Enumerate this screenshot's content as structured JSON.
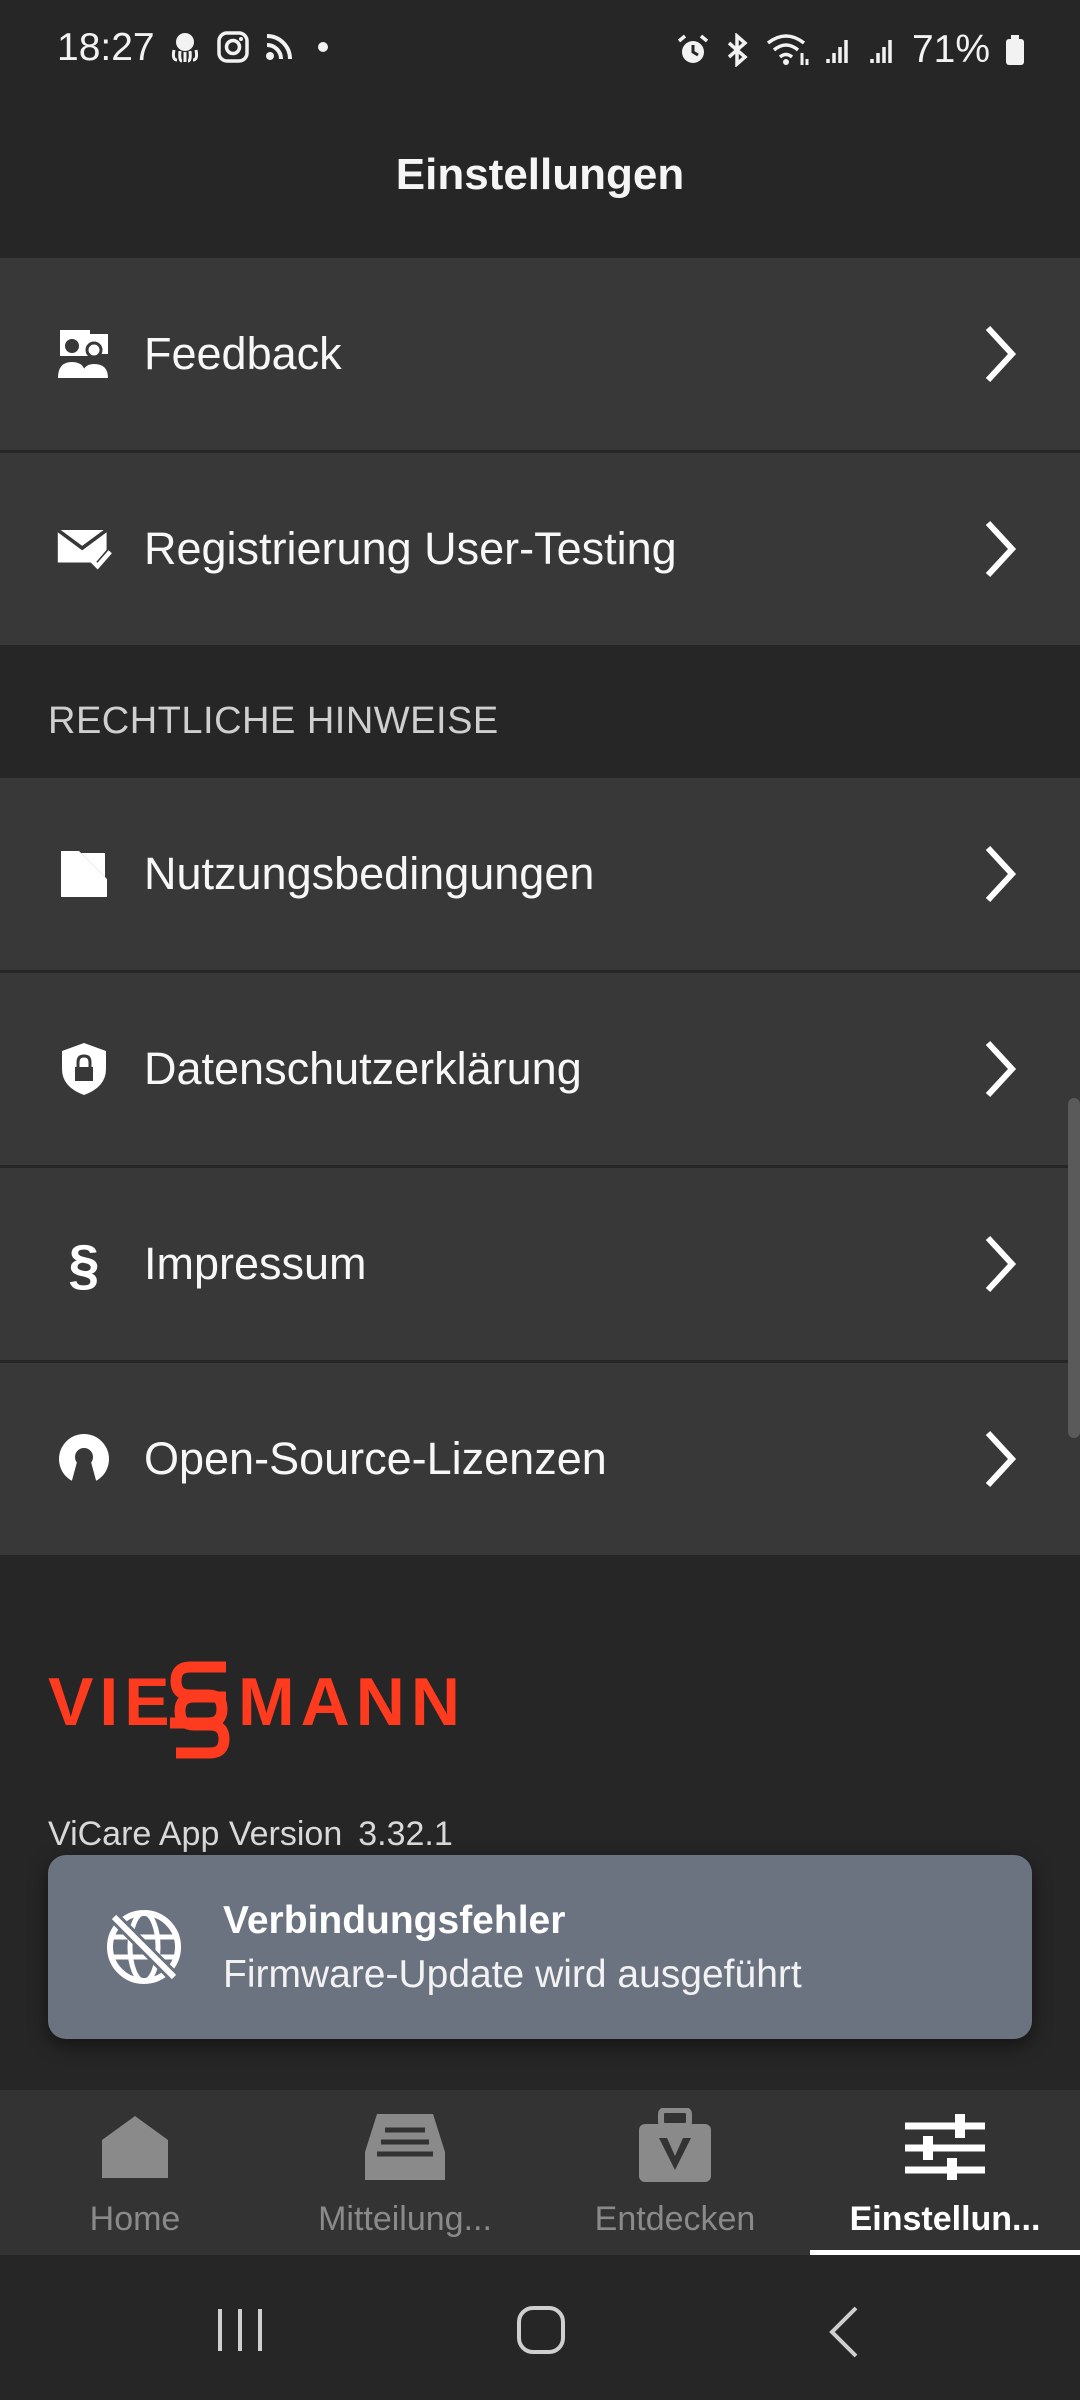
{
  "status_bar": {
    "time": "18:27",
    "battery": "71%",
    "left_icons": [
      "octopus-icon",
      "instagram-icon",
      "rss-icon",
      "dot-icon"
    ],
    "right_icons": [
      "alarm-icon",
      "bluetooth-icon",
      "wifi-icon",
      "signal-icon",
      "signal-icon",
      "battery-icon"
    ]
  },
  "header": {
    "title": "Einstellungen"
  },
  "settings": {
    "items": [
      {
        "label": "Feedback",
        "icon": "feedback-icon"
      },
      {
        "label": "Registrierung User-Testing",
        "icon": "mail-check-icon"
      }
    ]
  },
  "legal": {
    "header": "RECHTLICHE HINWEISE",
    "items": [
      {
        "label": "Nutzungsbedingungen",
        "icon": "document-icon"
      },
      {
        "label": "Datenschutzerklärung",
        "icon": "shield-lock-icon"
      },
      {
        "label": "Impressum",
        "icon": "paragraph-icon"
      },
      {
        "label": "Open-Source-Lizenzen",
        "icon": "open-source-icon"
      }
    ]
  },
  "brand": {
    "logo_text": "VIESSMANN",
    "color": "#ff3b1f"
  },
  "version": {
    "label": "ViCare App Version",
    "number": "3.32.1"
  },
  "snackbar": {
    "title": "Verbindungsfehler",
    "message": "Firmware-Update wird ausgeführt",
    "icon": "no-connection-globe-icon"
  },
  "bottom_nav": {
    "items": [
      {
        "label": "Home",
        "icon": "home-icon",
        "active": false
      },
      {
        "label": "Mitteilung...",
        "icon": "messages-icon",
        "active": false
      },
      {
        "label": "Entdecken",
        "icon": "discover-bag-icon",
        "active": false
      },
      {
        "label": "Einstellun...",
        "icon": "settings-sliders-icon",
        "active": true
      }
    ]
  },
  "colors": {
    "background": "#262626",
    "row": "#383838",
    "snackbar": "#6b7380",
    "accent": "#ff3b1f"
  }
}
